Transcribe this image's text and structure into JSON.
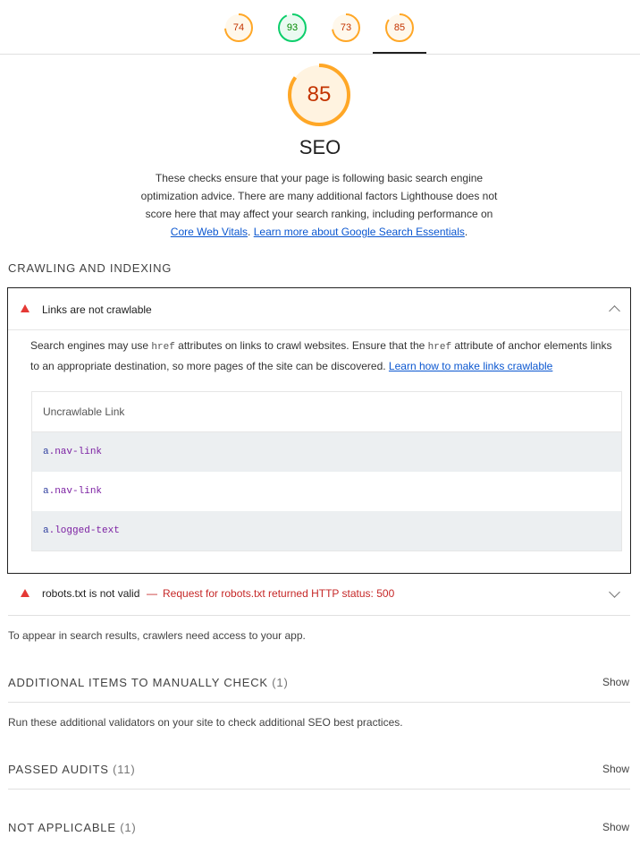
{
  "scores": [
    {
      "value": "74",
      "fraction": 0.74,
      "color": "#ffa726",
      "text_color": "#c33300",
      "bg": "#fff8ec"
    },
    {
      "value": "93",
      "fraction": 0.93,
      "color": "#0cce6b",
      "text_color": "#008800",
      "bg": "#eafaf1"
    },
    {
      "value": "73",
      "fraction": 0.73,
      "color": "#ffa726",
      "text_color": "#c33300",
      "bg": "#fff8ec"
    },
    {
      "value": "85",
      "fraction": 0.85,
      "color": "#ffa726",
      "text_color": "#c33300",
      "bg": "#fff8ec"
    }
  ],
  "main": {
    "score": "85",
    "fraction": 0.85,
    "title": "SEO",
    "description": "These checks ensure that your page is following basic search engine optimization advice. There are many additional factors Lighthouse does not score here that may affect your search ranking, including performance on",
    "link_cwv": "Core Web Vitals",
    "link_sep": ". ",
    "link_essentials": "Learn more about Google Search Essentials",
    "end_punct": "."
  },
  "crawling": {
    "heading": "CRAWLING AND INDEXING",
    "audit1": {
      "title": "Links are not crawlable",
      "desc_1": "Search engines may use ",
      "code_1": "href",
      "desc_2": " attributes on links to crawl websites. Ensure that the ",
      "code_2": "href",
      "desc_3": " attribute of anchor elements links to an appropriate destination, so more pages of the site can be discovered. ",
      "link": "Learn how to make links crawlable",
      "table_header": "Uncrawlable Link",
      "rows": [
        {
          "prefix": "a",
          "rest": ".nav-link"
        },
        {
          "prefix": "a",
          "rest": ".nav-link"
        },
        {
          "prefix": "a",
          "rest": ".logged-text"
        }
      ]
    },
    "audit2": {
      "title": "robots.txt is not valid",
      "dash": "—",
      "message": "Request for robots.txt returned HTTP status: 500"
    },
    "note": "To appear in search results, crawlers need access to your app."
  },
  "manual": {
    "label": "ADDITIONAL ITEMS TO MANUALLY CHECK",
    "count": "(1)",
    "show": "Show",
    "note": "Run these additional validators on your site to check additional SEO best practices."
  },
  "passed": {
    "label": "PASSED AUDITS",
    "count": "(11)",
    "show": "Show"
  },
  "na": {
    "label": "NOT APPLICABLE",
    "count": "(1)",
    "show": "Show"
  },
  "colors": {
    "fail": "#e53935",
    "link": "#0b57d0",
    "average": "#ffa726",
    "pass": "#0cce6b"
  }
}
